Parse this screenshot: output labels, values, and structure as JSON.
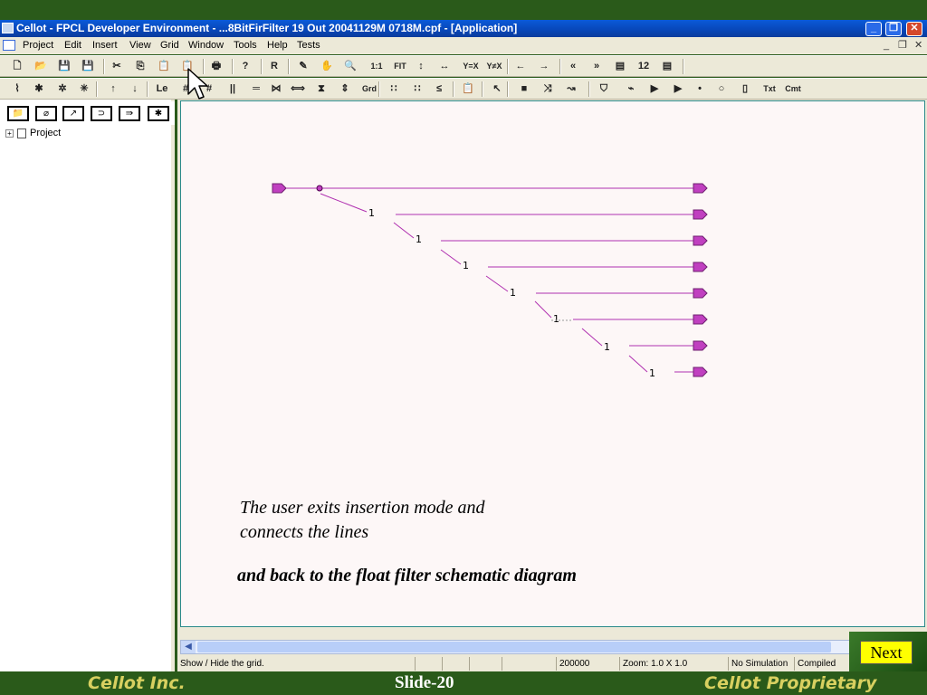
{
  "window": {
    "title": "Cellot - FPCL Developer Environment - ...8BitFirFilter 19 Out 20041129M 0718M.cpf - [Application]",
    "min": "_",
    "restore": "❐",
    "close": "✕"
  },
  "menu": {
    "items": [
      "Project",
      "Edit",
      "Insert",
      "View",
      "Grid",
      "Window",
      "Tools",
      "Help",
      "Tests"
    ],
    "mdi_controls": [
      "_",
      "❐",
      "✕"
    ]
  },
  "toolbar1": {
    "items": [
      {
        "name": "new-icon",
        "glyph": "🗋"
      },
      {
        "name": "open-icon",
        "glyph": "📂"
      },
      {
        "name": "save-icon",
        "glyph": "💾"
      },
      {
        "name": "save-all-icon",
        "glyph": "💾"
      },
      {
        "name": "cut-icon",
        "glyph": "✂"
      },
      {
        "name": "copy-icon",
        "glyph": "⎘"
      },
      {
        "name": "paste-icon",
        "glyph": "📋"
      },
      {
        "name": "paste-special-icon",
        "glyph": "📋"
      },
      {
        "name": "print-icon",
        "glyph": "🖶"
      },
      {
        "name": "help-icon",
        "glyph": "?"
      },
      {
        "name": "r-label",
        "glyph": "R"
      },
      {
        "name": "pencil-icon",
        "glyph": "✎"
      },
      {
        "name": "hand-icon",
        "glyph": "✋"
      },
      {
        "name": "zoom-icon",
        "glyph": "🔍"
      },
      {
        "name": "zoom-1to1",
        "glyph": "1:1"
      },
      {
        "name": "zoom-fit",
        "glyph": "FIT"
      },
      {
        "name": "fit-vertical-icon",
        "glyph": "↕"
      },
      {
        "name": "fit-horizontal-icon",
        "glyph": "↔"
      },
      {
        "name": "y-eq-x-icon",
        "glyph": "Y=X"
      },
      {
        "name": "y-neq-x-icon",
        "glyph": "Y≠X"
      },
      {
        "name": "arrow-left-icon",
        "glyph": "←"
      },
      {
        "name": "arrow-right-icon",
        "glyph": "→"
      },
      {
        "name": "double-left-icon",
        "glyph": "«"
      },
      {
        "name": "double-right-icon",
        "glyph": "»"
      },
      {
        "name": "page-icon",
        "glyph": "▤"
      },
      {
        "name": "page-number",
        "glyph": "12"
      },
      {
        "name": "page2-icon",
        "glyph": "▤"
      }
    ]
  },
  "toolbar2": {
    "items": [
      {
        "name": "schematic-icon",
        "glyph": "⌇"
      },
      {
        "name": "star-icon",
        "glyph": "✱"
      },
      {
        "name": "star2-icon",
        "glyph": "✲"
      },
      {
        "name": "star3-icon",
        "glyph": "✳"
      },
      {
        "name": "up-arrow-icon",
        "glyph": "↑"
      },
      {
        "name": "down-arrow-icon",
        "glyph": "↓"
      },
      {
        "name": "label-icon",
        "glyph": "Le"
      },
      {
        "name": "grid-icon",
        "glyph": "#"
      },
      {
        "name": "grid2-icon",
        "glyph": "#"
      },
      {
        "name": "vlines-icon",
        "glyph": "||"
      },
      {
        "name": "hlines-icon",
        "glyph": "═"
      },
      {
        "name": "connect-icon",
        "glyph": "⋈"
      },
      {
        "name": "connect2-icon",
        "glyph": "⟺"
      },
      {
        "name": "hourglass-icon",
        "glyph": "⧗"
      },
      {
        "name": "vexpand-icon",
        "glyph": "⇕"
      },
      {
        "name": "grd-off-icon",
        "glyph": "Grd Off"
      },
      {
        "name": "dots-icon",
        "glyph": "∷"
      },
      {
        "name": "dots2-icon",
        "glyph": "∷"
      },
      {
        "name": "lessthan-icon",
        "glyph": "≤"
      },
      {
        "name": "clipboard-icon",
        "glyph": "📋"
      },
      {
        "name": "pointer-icon",
        "glyph": "↖"
      },
      {
        "name": "rect-icon",
        "glyph": "■"
      },
      {
        "name": "cross-arrow-icon",
        "glyph": "⤨"
      },
      {
        "name": "curve-arrow-icon",
        "glyph": "↝"
      },
      {
        "name": "shield-icon",
        "glyph": "⛉"
      },
      {
        "name": "wire-icon",
        "glyph": "⌁"
      },
      {
        "name": "play-icon",
        "glyph": "▶"
      },
      {
        "name": "play2-icon",
        "glyph": "▶"
      },
      {
        "name": "dot-icon",
        "glyph": "•"
      },
      {
        "name": "ring-icon",
        "glyph": "○"
      },
      {
        "name": "box-icon",
        "glyph": "▯"
      },
      {
        "name": "text-tool",
        "glyph": "Txt"
      },
      {
        "name": "cmt-tool",
        "glyph": "Cmt"
      }
    ]
  },
  "palette": {
    "items": [
      "📁",
      "⌀",
      "↗",
      "⊃",
      "⇛",
      "✱"
    ]
  },
  "tree": {
    "root_label": "Project"
  },
  "schematic": {
    "line_color": "#b030b0",
    "port_color": "#c040c0"
  },
  "captions": {
    "line1": "The user exits insertion mode and",
    "line2": "connects the lines",
    "line3": "and back to the float filter schematic diagram"
  },
  "status": {
    "hint": "Show / Hide the grid.",
    "value": "200000",
    "zoom": "Zoom: 1.0 X 1.0",
    "sim": "No Simulation",
    "state": "Compiled"
  },
  "next_button": "Next",
  "footer": {
    "left": "Cellot Inc.",
    "center": "Slide-20",
    "right": "Cellot Proprietary"
  }
}
